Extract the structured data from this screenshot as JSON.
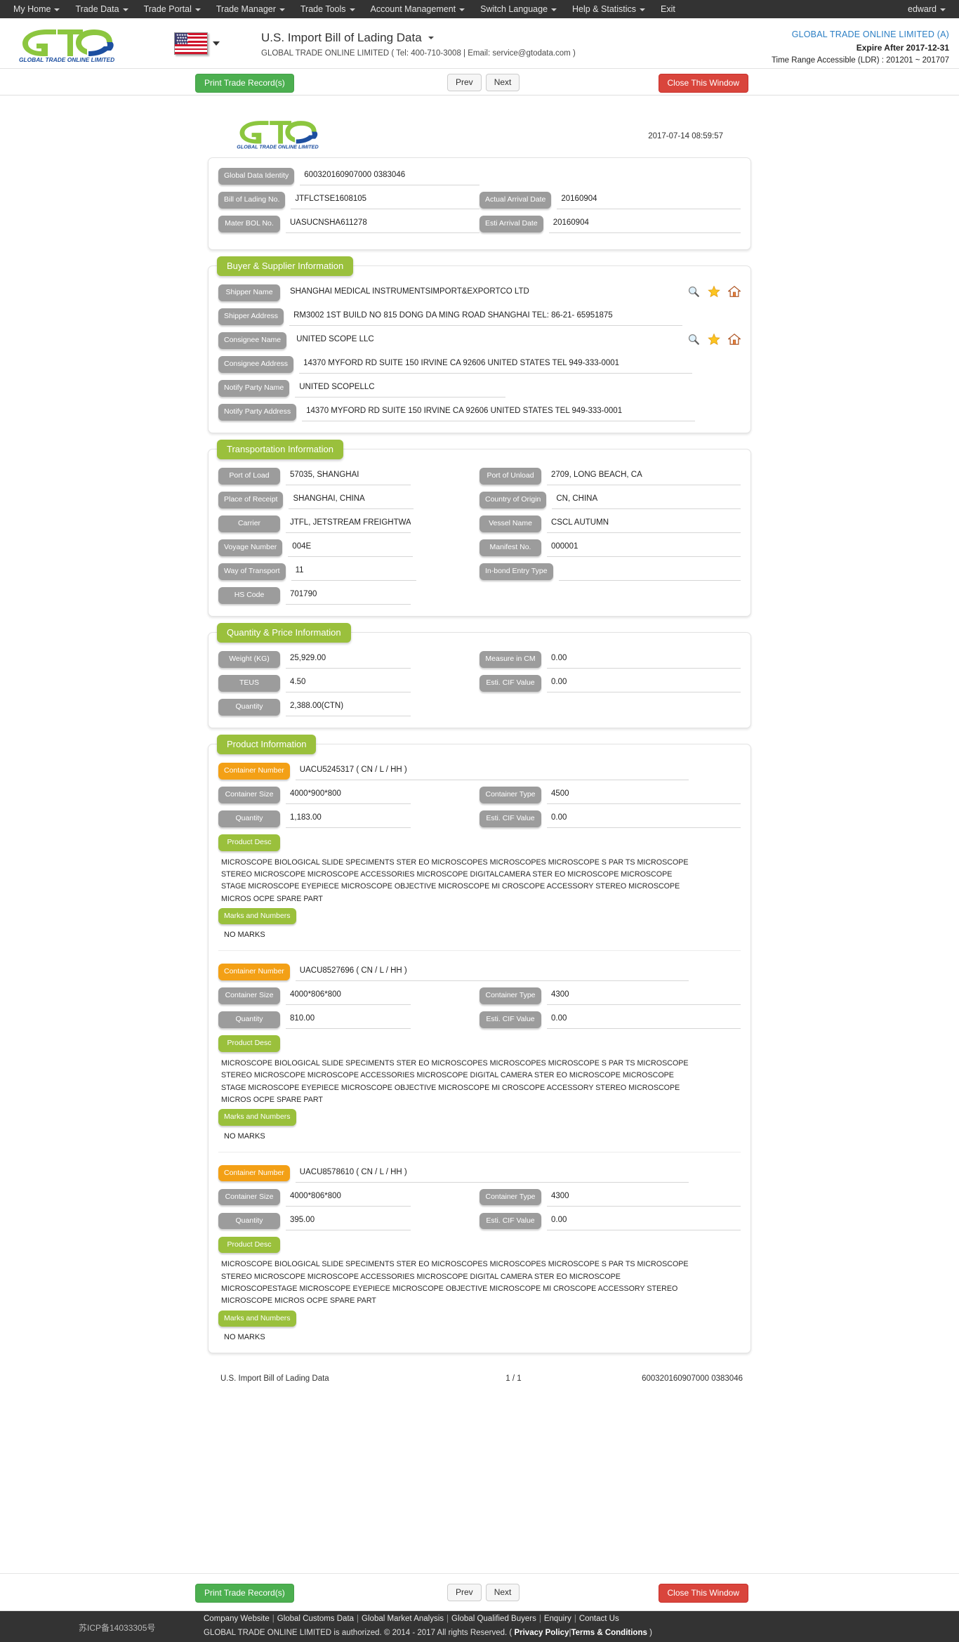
{
  "topnav": {
    "items": [
      {
        "label": "My Home",
        "caret": true
      },
      {
        "label": "Trade Data",
        "caret": true
      },
      {
        "label": "Trade Portal",
        "caret": true
      },
      {
        "label": "Trade Manager",
        "caret": true
      },
      {
        "label": "Trade Tools",
        "caret": true
      },
      {
        "label": "Account Management",
        "caret": true
      },
      {
        "label": "Switch Language",
        "caret": true
      },
      {
        "label": "Help & Statistics",
        "caret": true
      },
      {
        "label": "Exit",
        "caret": false
      }
    ],
    "user": "edward"
  },
  "header": {
    "logo_text": "GLOBAL TRADE  ONLINE LIMITED",
    "flag_icon": "us-flag-icon",
    "title": "U.S. Import Bill of Lading Data",
    "subtitle": "GLOBAL TRADE ONLINE LIMITED ( Tel: 400-710-3008 | Email: service@gtodata.com )",
    "account_name": "GLOBAL TRADE ONLINE LIMITED (A)",
    "expire": "Expire After 2017-12-31",
    "time_range": "Time Range Accessible (LDR) : 201201 ~ 201707"
  },
  "toolbar": {
    "print_label": "Print Trade Record(s)",
    "prev_label": "Prev",
    "next_label": "Next",
    "close_label": "Close This Window"
  },
  "document": {
    "timestamp": "2017-07-14 08:59:57",
    "identity": {
      "global_data_identity_label": "Global Data Identity",
      "global_data_identity_value": "600320160907000 0383046",
      "bill_of_lading_label": "Bill of Lading No.",
      "bill_of_lading_value": "JTFLCTSE1608105",
      "actual_arrival_label": "Actual Arrival Date",
      "actual_arrival_value": "20160904",
      "master_bol_label": "Mater BOL No.",
      "master_bol_value": "UASUCNSHA611278",
      "esti_arrival_label": "Esti Arrival Date",
      "esti_arrival_value": "20160904"
    },
    "buyer_supplier": {
      "title": "Buyer & Supplier Information",
      "shipper_name_label": "Shipper Name",
      "shipper_name_value": "SHANGHAI MEDICAL INSTRUMENTSIMPORT&EXPORTCO LTD",
      "shipper_address_label": "Shipper Address",
      "shipper_address_value": "RM3002 1ST BUILD NO 815 DONG DA MING ROAD SHANGHAI TEL: 86-21- 65951875",
      "consignee_name_label": "Consignee Name",
      "consignee_name_value": "UNITED SCOPE LLC",
      "consignee_address_label": "Consignee Address",
      "consignee_address_value": "14370 MYFORD RD SUITE 150 IRVINE CA 92606 UNITED STATES TEL 949-333-0001",
      "notify_name_label": "Notify Party Name",
      "notify_name_value": "UNITED SCOPELLC",
      "notify_address_label": "Notify Party Address",
      "notify_address_value": "14370 MYFORD RD SUITE 150 IRVINE CA 92606 UNITED STATES TEL 949-333-0001"
    },
    "transportation": {
      "title": "Transportation Information",
      "port_of_load_label": "Port of Load",
      "port_of_load_value": "57035, SHANGHAI",
      "port_of_unload_label": "Port of Unload",
      "port_of_unload_value": "2709, LONG BEACH, CA",
      "place_of_receipt_label": "Place of Receipt",
      "place_of_receipt_value": "SHANGHAI, CHINA",
      "country_of_origin_label": "Country of Origin",
      "country_of_origin_value": "CN, CHINA",
      "carrier_label": "Carrier",
      "carrier_value": "JTFL, JETSTREAM FREIGHTWAYS LIMITED",
      "vessel_name_label": "Vessel Name",
      "vessel_name_value": "CSCL AUTUMN",
      "voyage_number_label": "Voyage Number",
      "voyage_number_value": "004E",
      "manifest_no_label": "Manifest No.",
      "manifest_no_value": "000001",
      "way_of_transport_label": "Way of Transport",
      "way_of_transport_value": "11",
      "inbond_entry_label": "In-bond Entry Type",
      "inbond_entry_value": "",
      "hs_code_label": "HS Code",
      "hs_code_value": "701790"
    },
    "quantity_price": {
      "title": "Quantity & Price Information",
      "weight_label": "Weight (KG)",
      "weight_value": "25,929.00",
      "measure_label": "Measure in CM",
      "measure_value": "0.00",
      "teus_label": "TEUS",
      "teus_value": "4.50",
      "cif_label": "Esti. CIF Value",
      "cif_value": "0.00",
      "quantity_label": "Quantity",
      "quantity_value": "2,388.00(CTN)"
    },
    "product_information": {
      "title": "Product Information",
      "container_number_label": "Container Number",
      "container_size_label": "Container Size",
      "container_type_label": "Container Type",
      "quantity_label": "Quantity",
      "cif_label": "Esti. CIF Value",
      "product_desc_label": "Product Desc",
      "marks_label": "Marks and Numbers",
      "containers": [
        {
          "number": "UACU5245317 ( CN / L / HH )",
          "size": "4000*900*800",
          "type": "4500",
          "quantity": "1,183.00",
          "cif": "0.00",
          "desc": "MICROSCOPE BIOLOGICAL SLIDE SPECIMENTS STER EO MICROSCOPES MICROSCOPES MICROSCOPE S PAR TS MICROSCOPE STEREO MICROSCOPE MICROSCOPE ACCESSORIES MICROSCOPE DIGITALCAMERA STER EO MICROSCOPE MICROSCOPE STAGE MICROSCOPE EYEPIECE MICROSCOPE OBJECTIVE MICROSCOPE MI CROSCOPE ACCESSORY STEREO MICROSCOPE MICROS OCPE SPARE PART",
          "marks": "NO MARKS"
        },
        {
          "number": "UACU8527696 ( CN / L / HH )",
          "size": "4000*806*800",
          "type": "4300",
          "quantity": "810.00",
          "cif": "0.00",
          "desc": "MICROSCOPE BIOLOGICAL SLIDE SPECIMENTS STER EO MICROSCOPES MICROSCOPES MICROSCOPE S PAR TS MICROSCOPE STEREO MICROSCOPE MICROSCOPE ACCESSORIES MICROSCOPE DIGITAL CAMERA STER EO MICROSCOPE MICROSCOPE STAGE MICROSCOPE EYEPIECE MICROSCOPE OBJECTIVE MICROSCOPE MI CROSCOPE ACCESSORY STEREO MICROSCOPE MICROS OCPE SPARE PART",
          "marks": "NO MARKS"
        },
        {
          "number": "UACU8578610 ( CN / L / HH )",
          "size": "4000*806*800",
          "type": "4300",
          "quantity": "395.00",
          "cif": "0.00",
          "desc": "MICROSCOPE BIOLOGICAL SLIDE SPECIMENTS STER EO MICROSCOPES MICROSCOPES MICROSCOPE S PAR TS MICROSCOPE STEREO MICROSCOPE MICROSCOPE ACCESSORIES MICROSCOPE DIGITAL CAMERA STER EO MICROSCOPE MICROSCOPESTAGE MICROSCOPE EYEPIECE MICROSCOPE OBJECTIVE MICROSCOPE MI CROSCOPE ACCESSORY STEREO MICROSCOPE MICROS OCPE SPARE PART",
          "marks": "NO MARKS"
        }
      ]
    },
    "footer": {
      "left": "U.S. Import Bill of Lading Data",
      "center": "1 / 1",
      "right": "600320160907000 0383046"
    }
  },
  "page_footer": {
    "icp": "苏ICP备14033305号",
    "links": [
      "Company Website",
      "Global Customs Data",
      "Global Market Analysis",
      "Global Qualified Buyers",
      "Enquiry",
      "Contact Us"
    ],
    "copyright_prefix": "GLOBAL TRADE ONLINE LIMITED is authorized. © 2014 - 2017 All rights Reserved.  (",
    "privacy_label": "Privacy Policy",
    "terms_label": "Terms & Conditions",
    "copyright_suffix": ")"
  },
  "icons": {
    "search": "magnifier-icon",
    "star": "star-icon",
    "home": "home-icon"
  },
  "colors": {
    "accent_green": "#9ac03c",
    "orange": "#f3a016",
    "label_gray": "#9c9c9c",
    "nav_dark": "#333333",
    "link_blue": "#2c7fc4",
    "danger_red": "#d9453c"
  }
}
